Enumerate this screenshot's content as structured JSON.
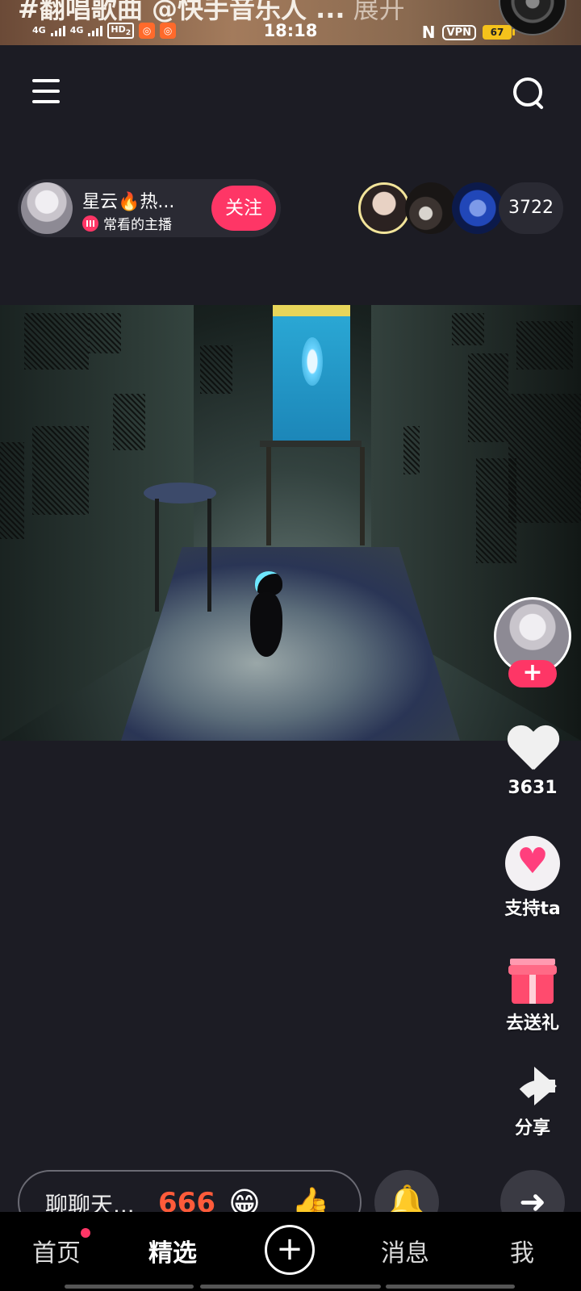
{
  "banner": {
    "text": "#翻唱歌曲 @快手音乐人 ...",
    "expand_label": "展开"
  },
  "status_bar": {
    "network_1": "4G",
    "network_2": "4G",
    "hd": "HD",
    "hd_sub": "2",
    "time": "18:18",
    "vpn": "VPN",
    "battery": "67"
  },
  "header": {
    "menu_icon": "menu-icon",
    "search_icon": "search-icon"
  },
  "streamer": {
    "name": "星云🔥热...",
    "subtitle": "常看的主播",
    "follow_label": "关注"
  },
  "audience": {
    "viewer_count": "3722"
  },
  "rail": {
    "follow_plus": "+",
    "like_count": "3631",
    "support_label": "支持ta",
    "gift_label": "去送礼",
    "share_label": "分享"
  },
  "comment_bar": {
    "placeholder": "聊聊天...",
    "emoji_fire": "666",
    "emoji_grin": "😁",
    "emoji_thumb": "👍",
    "fan_icon": "🔔",
    "arrow": "➜"
  },
  "bottom_nav": {
    "home": "首页",
    "featured": "精选",
    "create": "+",
    "messages": "消息",
    "me": "我"
  },
  "colors": {
    "accent": "#fe3666",
    "background": "#1c1c24"
  }
}
